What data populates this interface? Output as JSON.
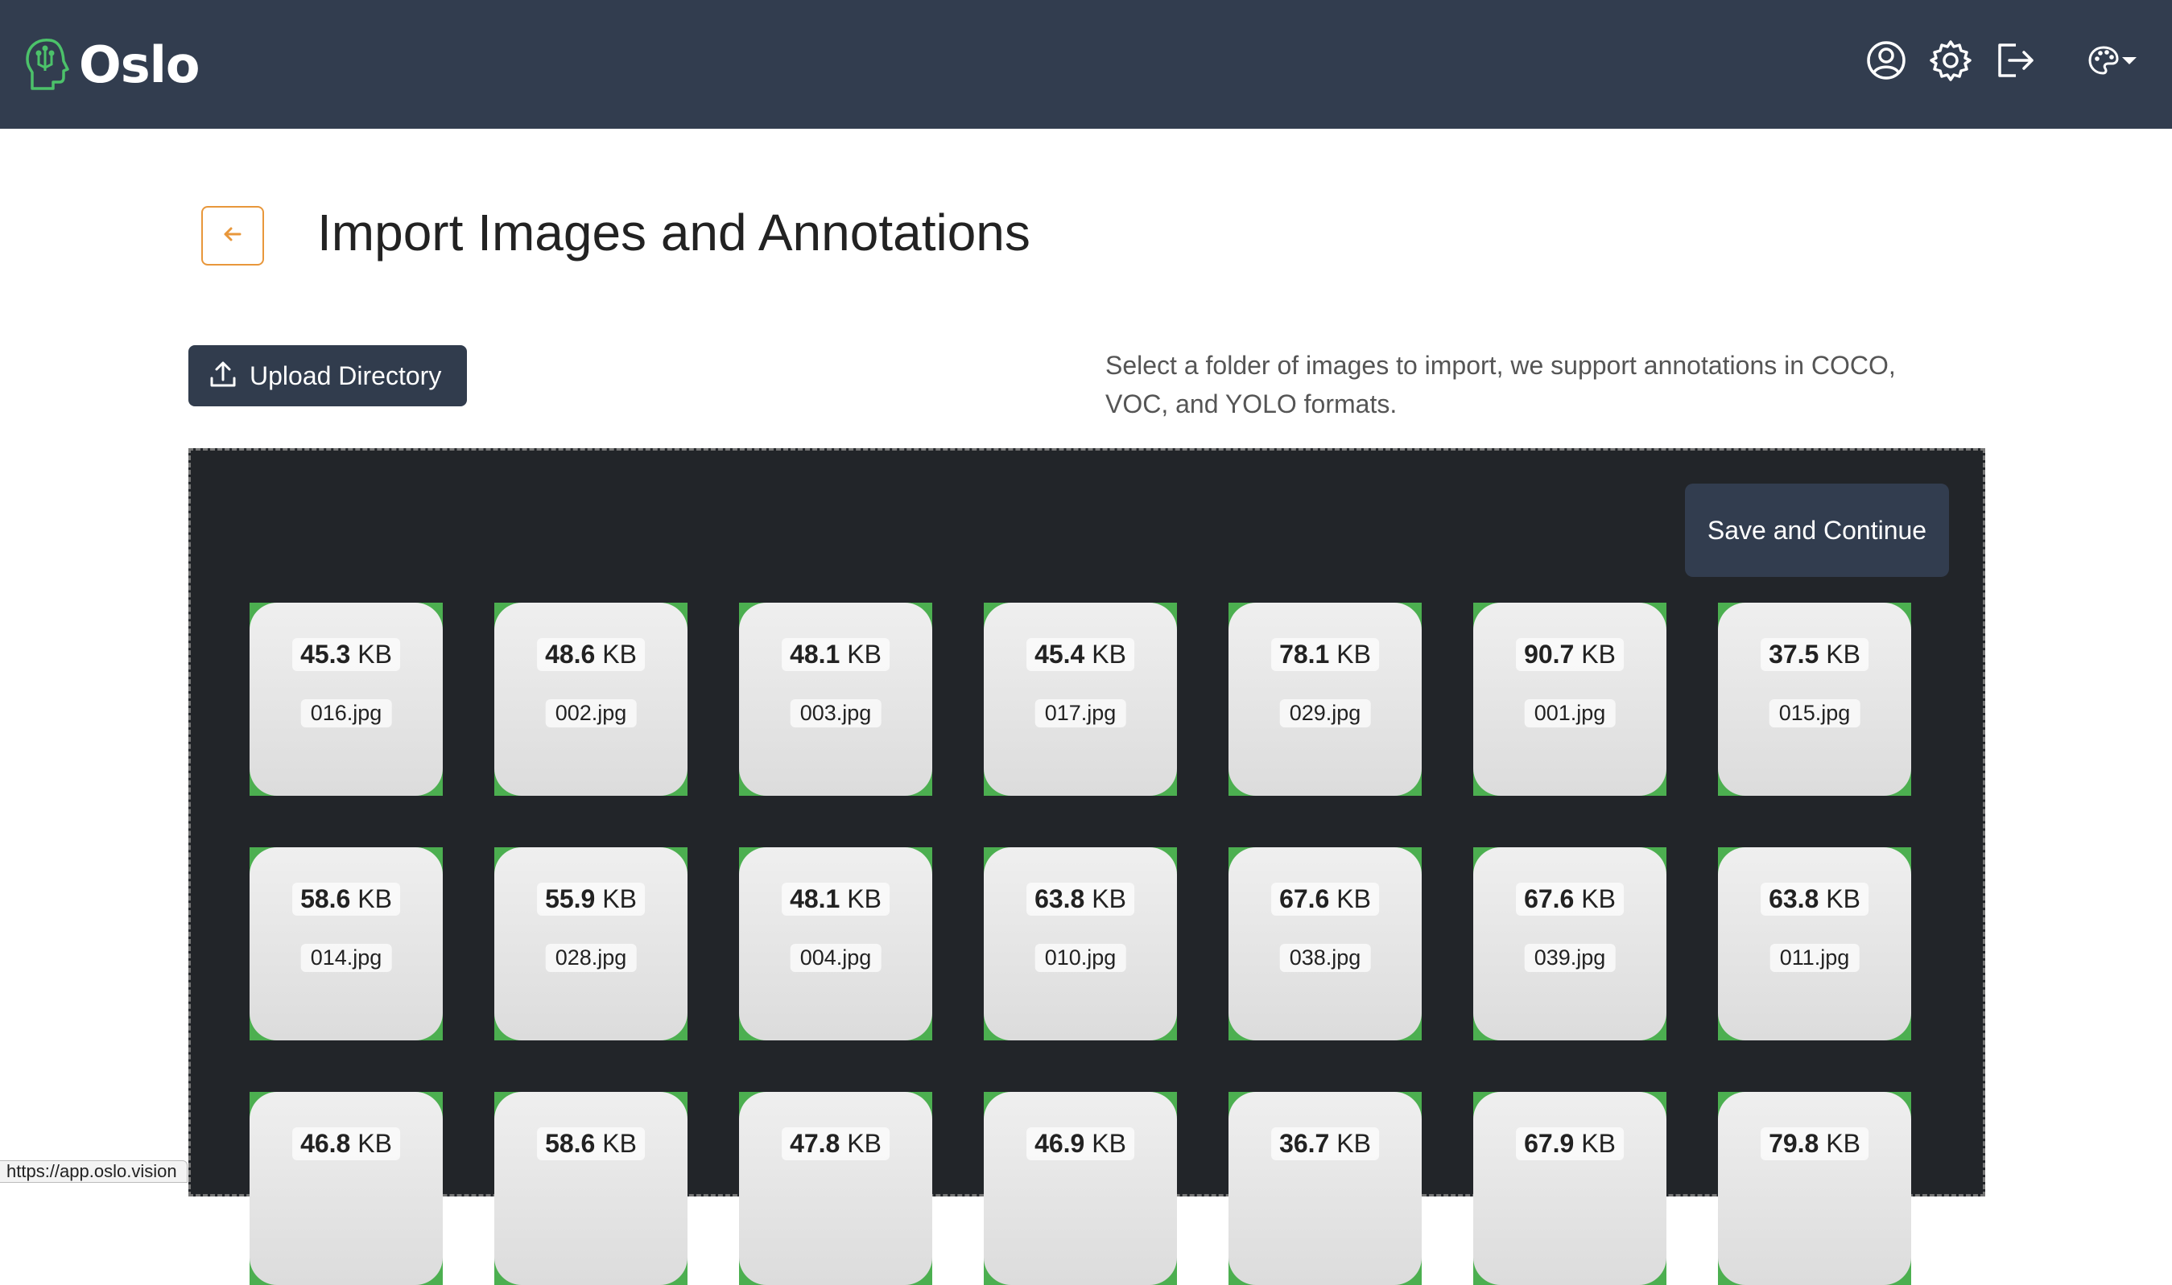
{
  "header": {
    "brand_name": "Oslo",
    "icons": [
      "user-circle-icon",
      "gear-icon",
      "logout-icon",
      "palette-icon",
      "caret-down-icon"
    ]
  },
  "page": {
    "title": "Import Images and Annotations",
    "upload_label": "Upload Directory",
    "description": "Select a folder of images to import, we support annotations in COCO, VOC, and YOLO formats.",
    "save_label": "Save and Continue"
  },
  "files": [
    {
      "value": "45.3",
      "unit": "KB",
      "name": "016.jpg"
    },
    {
      "value": "48.6",
      "unit": "KB",
      "name": "002.jpg"
    },
    {
      "value": "48.1",
      "unit": "KB",
      "name": "003.jpg"
    },
    {
      "value": "45.4",
      "unit": "KB",
      "name": "017.jpg"
    },
    {
      "value": "78.1",
      "unit": "KB",
      "name": "029.jpg"
    },
    {
      "value": "90.7",
      "unit": "KB",
      "name": "001.jpg"
    },
    {
      "value": "37.5",
      "unit": "KB",
      "name": "015.jpg"
    },
    {
      "value": "58.6",
      "unit": "KB",
      "name": "014.jpg"
    },
    {
      "value": "55.9",
      "unit": "KB",
      "name": "028.jpg"
    },
    {
      "value": "48.1",
      "unit": "KB",
      "name": "004.jpg"
    },
    {
      "value": "63.8",
      "unit": "KB",
      "name": "010.jpg"
    },
    {
      "value": "67.6",
      "unit": "KB",
      "name": "038.jpg"
    },
    {
      "value": "67.6",
      "unit": "KB",
      "name": "039.jpg"
    },
    {
      "value": "63.8",
      "unit": "KB",
      "name": "011.jpg"
    },
    {
      "value": "46.8",
      "unit": "KB",
      "name": ""
    },
    {
      "value": "58.6",
      "unit": "KB",
      "name": ""
    },
    {
      "value": "47.8",
      "unit": "KB",
      "name": ""
    },
    {
      "value": "46.9",
      "unit": "KB",
      "name": ""
    },
    {
      "value": "36.7",
      "unit": "KB",
      "name": ""
    },
    {
      "value": "67.9",
      "unit": "KB",
      "name": ""
    },
    {
      "value": "79.8",
      "unit": "KB",
      "name": ""
    }
  ],
  "status_bar": {
    "url": "https://app.oslo.vision"
  },
  "colors": {
    "header_bg": "#323d4f",
    "accent_orange": "#e8973b",
    "thumb_border_green": "#4caf50",
    "dropzone_bg": "#222529"
  }
}
